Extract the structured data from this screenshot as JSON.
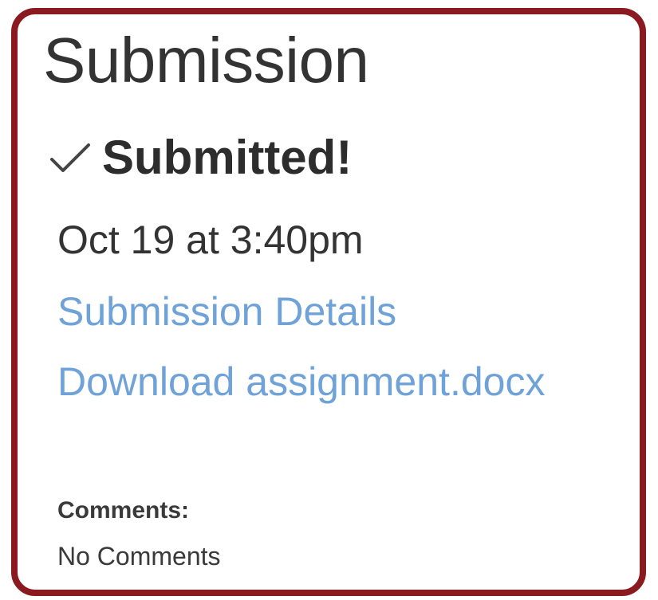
{
  "submission": {
    "title": "Submission",
    "status_icon": "checkmark-icon",
    "status": "Submitted!",
    "timestamp": "Oct 19 at 3:40pm",
    "details_link": "Submission Details",
    "download_link": "Download assignment.docx",
    "comments_label": "Comments:",
    "comments_value": "No Comments"
  },
  "colors": {
    "frame_border": "#8a1a1f",
    "link": "#6ea2d8",
    "text": "#333333"
  }
}
